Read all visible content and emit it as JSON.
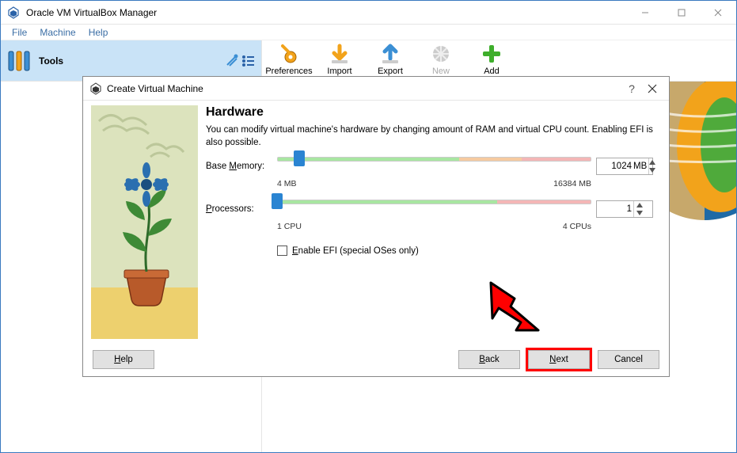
{
  "app": {
    "title": "Oracle VM VirtualBox Manager"
  },
  "menu": {
    "file": "File",
    "machine": "Machine",
    "help": "Help"
  },
  "sidebar": {
    "tools_label": "Tools"
  },
  "toolbar": {
    "preferences": "Preferences",
    "import": "Import",
    "export": "Export",
    "new": "New",
    "add": "Add"
  },
  "modal": {
    "title": "Create Virtual Machine",
    "heading": "Hardware",
    "description": "You can modify virtual machine's hardware by changing amount of RAM and virtual CPU count. Enabling EFI is also possible.",
    "base_memory_label": "Base Memory:",
    "base_memory_value": "1024",
    "base_memory_unit": "MB",
    "ram_min": "4 MB",
    "ram_max": "16384 MB",
    "processors_label": "Processors:",
    "processors_value": "1",
    "cpu_min": "1 CPU",
    "cpu_max": "4 CPUs",
    "efi_label": "Enable EFI (special OSes only)",
    "help_btn": "Help",
    "back_btn": "Back",
    "next_btn": "Next",
    "cancel_btn": "Cancel"
  }
}
